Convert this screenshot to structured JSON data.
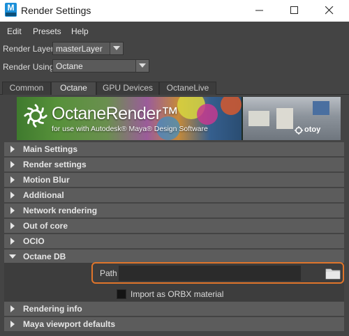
{
  "window": {
    "title": "Render Settings",
    "app_icon_letter": "M",
    "accent": "#1b8fd8"
  },
  "menu": [
    "Edit",
    "Presets",
    "Help"
  ],
  "render_layer": {
    "label": "Render Layer",
    "value": "masterLayer"
  },
  "render_using": {
    "label": "Render Using",
    "value": "Octane"
  },
  "tabs": [
    {
      "label": "Common",
      "active": false
    },
    {
      "label": "Octane",
      "active": true
    },
    {
      "label": "GPU Devices",
      "active": false
    },
    {
      "label": "OctaneLive",
      "active": false
    }
  ],
  "banner": {
    "title": "OctaneRender™",
    "subtitle": "for use with Autodesk® Maya® Design Software",
    "brand": "otoy"
  },
  "sections": [
    {
      "label": "Main Settings",
      "expanded": false
    },
    {
      "label": "Render settings",
      "expanded": false
    },
    {
      "label": "Motion Blur",
      "expanded": false
    },
    {
      "label": "Additional",
      "expanded": false
    },
    {
      "label": "Network rendering",
      "expanded": false
    },
    {
      "label": "Out of core",
      "expanded": false
    },
    {
      "label": "OCIO",
      "expanded": false
    },
    {
      "label": "Octane DB",
      "expanded": true
    },
    {
      "label": "Rendering info",
      "expanded": false
    },
    {
      "label": "Maya viewport defaults",
      "expanded": false
    }
  ],
  "octane_db": {
    "path_label": "Path",
    "path_value": "",
    "import_orbx_label": "Import as ORBX material",
    "import_orbx_checked": false,
    "highlight_color": "#e0752b"
  },
  "icons": {
    "minimize": "minimize-icon",
    "maximize": "maximize-icon",
    "close": "close-icon",
    "dropdown": "chevron-down-icon",
    "collapsed": "triangle-right-icon",
    "expanded": "triangle-down-icon",
    "browse": "folder-icon"
  }
}
